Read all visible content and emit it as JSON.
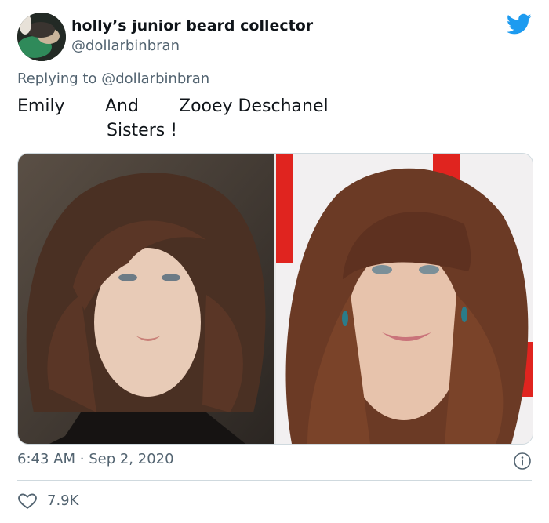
{
  "tweet": {
    "display_name": "holly’s junior beard collector",
    "handle": "@dollarbinbran",
    "replying_to_prefix": "Replying to ",
    "replying_to_handle": "@dollarbinbran",
    "text_words": [
      "Emily",
      "And",
      "Zooey Deschanel",
      "Sisters !"
    ],
    "time": "6:43 AM",
    "separator": "·",
    "date": "Sep 2, 2020",
    "like_count": "7.9K"
  },
  "icons": {
    "logo": "twitter-bird-icon",
    "info": "info-icon",
    "like": "heart-icon"
  },
  "colors": {
    "brand": "#1d9bf0",
    "text": "#0f1419",
    "muted": "#536471",
    "border": "#cfd9de"
  }
}
